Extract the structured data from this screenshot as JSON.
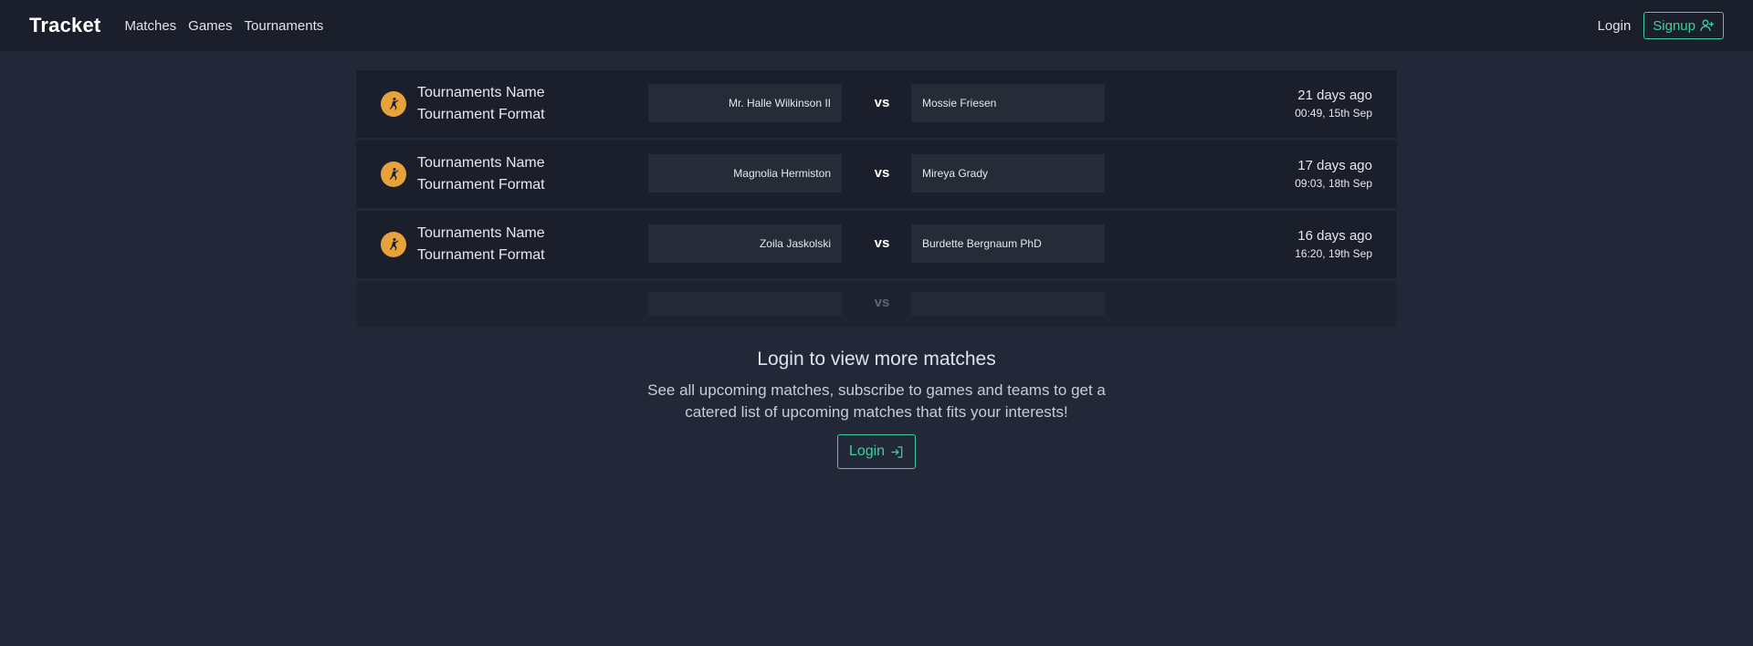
{
  "nav": {
    "brand": "Tracket",
    "links": [
      "Matches",
      "Games",
      "Tournaments"
    ],
    "login": "Login",
    "signup": "Signup"
  },
  "matches": [
    {
      "tournament_name": "Tournaments Name",
      "tournament_format": "Tournament Format",
      "team_a": "Mr. Halle Wilkinson II",
      "vs": "vs",
      "team_b": "Mossie Friesen",
      "ago": "21 days ago",
      "date": "00:49, 15th Sep"
    },
    {
      "tournament_name": "Tournaments Name",
      "tournament_format": "Tournament Format",
      "team_a": "Magnolia Hermiston",
      "vs": "vs",
      "team_b": "Mireya Grady",
      "ago": "17 days ago",
      "date": "09:03, 18th Sep"
    },
    {
      "tournament_name": "Tournaments Name",
      "tournament_format": "Tournament Format",
      "team_a": "Zoila Jaskolski",
      "vs": "vs",
      "team_b": "Burdette Bergnaum PhD",
      "ago": "16 days ago",
      "date": "16:20, 19th Sep"
    }
  ],
  "placeholder": {
    "vs": "vs"
  },
  "cta": {
    "title": "Login to view more matches",
    "line1": "See all upcoming matches, subscribe to games and teams to get a",
    "line2": "catered list of upcoming matches that fits your interests!",
    "button": "Login"
  },
  "colors": {
    "accent": "#3fcf9c",
    "game_icon": "#e8a23b"
  },
  "icons": {
    "signup": "user-plus-icon",
    "login": "login-arrow-icon",
    "game": "counter-strike-icon"
  }
}
